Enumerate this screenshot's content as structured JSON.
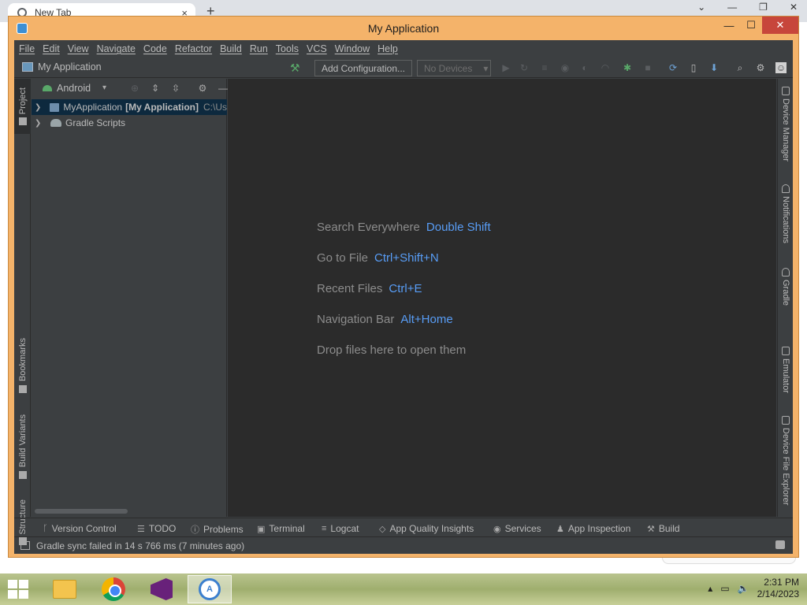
{
  "browser": {
    "tab_title": "New Tab",
    "close_glyph": "×",
    "new_tab_glyph": "+",
    "right_controls": [
      "⌄",
      "—",
      "❐",
      "✕"
    ]
  },
  "window": {
    "title": "My Application",
    "controls": {
      "minimize": "—",
      "maximize": "☐",
      "close": "✕"
    }
  },
  "menu": [
    "File",
    "Edit",
    "View",
    "Navigate",
    "Code",
    "Refactor",
    "Build",
    "Run",
    "Tools",
    "VCS",
    "Window",
    "Help"
  ],
  "toolbar": {
    "project_name": "My Application",
    "add_configuration": "Add Configuration...",
    "devices": "No Devices",
    "devices_caret": "▾",
    "icons": [
      "hammer-icon",
      "run-icon",
      "rerun-icon",
      "coverage-icon",
      "profile-icon",
      "attach-icon",
      "apply-changes-icon",
      "debug-icon",
      "stop-icon",
      "sync-gradle-icon",
      "device-manager-icon",
      "sdk-manager-icon",
      "search-icon",
      "settings-icon",
      "account-icon"
    ]
  },
  "left_tabs": {
    "project": "Project",
    "bookmarks": "Bookmarks",
    "build_variants": "Build Variants",
    "structure": "Structure"
  },
  "project_panel": {
    "view": "Android",
    "caret": "▾",
    "tree": [
      {
        "name": "MyApplication",
        "module": "[My Application]",
        "path": "C:\\Us",
        "selected": true
      },
      {
        "name": "Gradle Scripts",
        "module": "",
        "path": "",
        "selected": false
      }
    ]
  },
  "editor_hints": [
    {
      "label": "Search Everywhere",
      "shortcut": "Double Shift"
    },
    {
      "label": "Go to File",
      "shortcut": "Ctrl+Shift+N"
    },
    {
      "label": "Recent Files",
      "shortcut": "Ctrl+E"
    },
    {
      "label": "Navigation Bar",
      "shortcut": "Alt+Home"
    },
    {
      "label": "Drop files here to open them",
      "shortcut": ""
    }
  ],
  "right_tabs": [
    "Device Manager",
    "Notifications",
    "Gradle",
    "Emulator",
    "Device File Explorer"
  ],
  "bottom_tabs": [
    "Version Control",
    "TODO",
    "Problems",
    "Terminal",
    "Logcat",
    "App Quality Insights",
    "Services",
    "App Inspection",
    "Build"
  ],
  "status": {
    "message": "Gradle sync failed in 14 s 766 ms (7 minutes ago)"
  },
  "taskbar": {
    "apps": [
      "file-explorer",
      "chrome",
      "visual-studio",
      "android-studio"
    ],
    "time": "2:31 PM",
    "date": "2/14/2023"
  },
  "colors": {
    "ide_bg": "#3c3f41",
    "editor_bg": "#2b2b2b",
    "shortcut_blue": "#589df6",
    "window_frame": "#f4b36a",
    "selection": "#0d293e"
  }
}
